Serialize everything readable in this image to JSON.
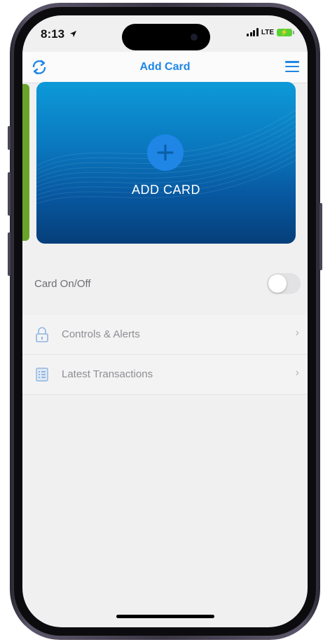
{
  "status_bar": {
    "time": "8:13",
    "network": "LTE"
  },
  "nav": {
    "title": "Add Card"
  },
  "card": {
    "label": "ADD CARD"
  },
  "card_toggle": {
    "label": "Card On/Off",
    "state": "off"
  },
  "menu_items": [
    {
      "label": "Controls & Alerts",
      "icon": "lock-icon"
    },
    {
      "label": "Latest Transactions",
      "icon": "receipt-icon"
    }
  ],
  "colors": {
    "accent": "#1f86e6",
    "card_top": "#0d9ad8",
    "card_bottom": "#063f7a",
    "side_card": "#6aa32a"
  }
}
